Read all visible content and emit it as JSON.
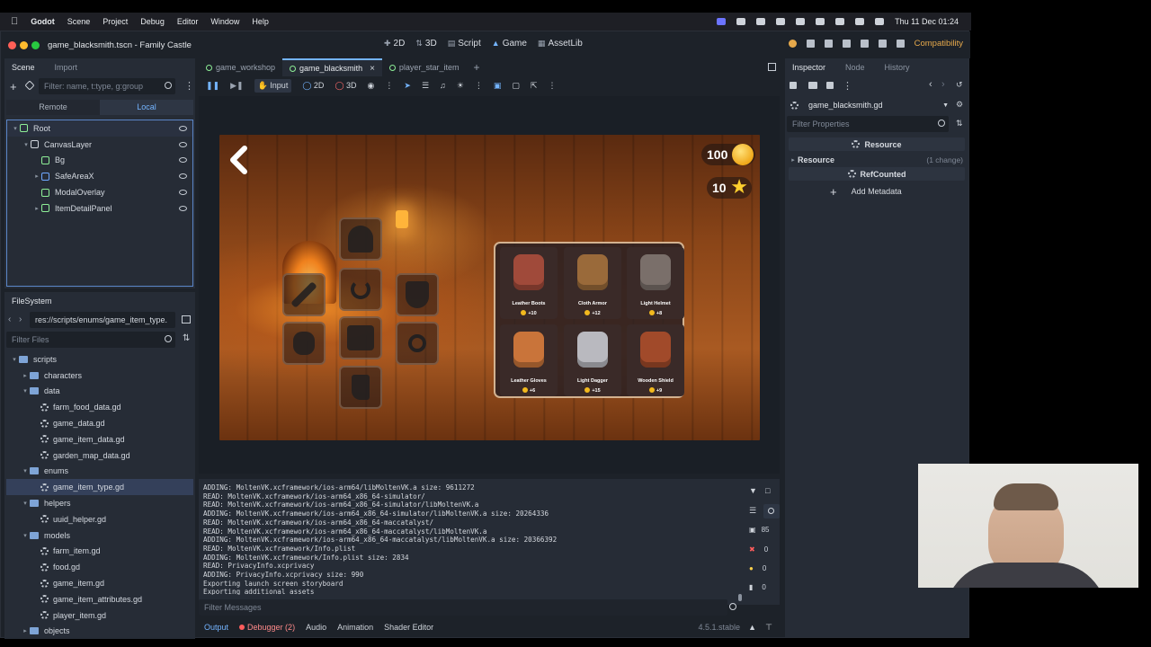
{
  "menubar": {
    "app_name": "Godot",
    "items": [
      "Scene",
      "Project",
      "Debug",
      "Editor",
      "Window",
      "Help"
    ],
    "clock": "Thu 11 Dec  01:24"
  },
  "window": {
    "title": "game_blacksmith.tscn - Family Castle",
    "main_screens": [
      "2D",
      "3D",
      "Script",
      "Game",
      "AssetLib"
    ],
    "active_screen": "Game",
    "renderer": "Compatibility"
  },
  "scene_dock": {
    "tabs": [
      "Scene",
      "Import"
    ],
    "filter_placeholder": "Filter: name, t:type, g:group",
    "remote_label": "Remote",
    "local_label": "Local",
    "nodes": [
      {
        "name": "Root",
        "depth": 0,
        "color": "#8eef97"
      },
      {
        "name": "CanvasLayer",
        "depth": 1,
        "color": "#d0d5dc"
      },
      {
        "name": "Bg",
        "depth": 2,
        "color": "#8eef97"
      },
      {
        "name": "SafeAreaX",
        "depth": 2,
        "color": "#6fa8ff"
      },
      {
        "name": "ModalOverlay",
        "depth": 2,
        "color": "#8eef97"
      },
      {
        "name": "ItemDetailPanel",
        "depth": 2,
        "color": "#8eef97"
      }
    ]
  },
  "filesystem": {
    "tab": "FileSystem",
    "path": "res://scripts/enums/game_item_type.",
    "filter_placeholder": "Filter Files",
    "entries": [
      {
        "name": "scripts",
        "type": "folder",
        "depth": 0
      },
      {
        "name": "characters",
        "type": "folder",
        "depth": 1
      },
      {
        "name": "data",
        "type": "folder",
        "depth": 1
      },
      {
        "name": "farm_food_data.gd",
        "type": "file",
        "depth": 2
      },
      {
        "name": "game_data.gd",
        "type": "file",
        "depth": 2
      },
      {
        "name": "game_item_data.gd",
        "type": "file",
        "depth": 2
      },
      {
        "name": "garden_map_data.gd",
        "type": "file",
        "depth": 2
      },
      {
        "name": "enums",
        "type": "folder",
        "depth": 1
      },
      {
        "name": "game_item_type.gd",
        "type": "file",
        "depth": 2,
        "selected": true
      },
      {
        "name": "helpers",
        "type": "folder",
        "depth": 1
      },
      {
        "name": "uuid_helper.gd",
        "type": "file",
        "depth": 2
      },
      {
        "name": "models",
        "type": "folder",
        "depth": 1
      },
      {
        "name": "farm_item.gd",
        "type": "file",
        "depth": 2
      },
      {
        "name": "food.gd",
        "type": "file",
        "depth": 2
      },
      {
        "name": "game_item.gd",
        "type": "file",
        "depth": 2
      },
      {
        "name": "game_item_attributes.gd",
        "type": "file",
        "depth": 2
      },
      {
        "name": "player_item.gd",
        "type": "file",
        "depth": 2
      },
      {
        "name": "objects",
        "type": "folder",
        "depth": 1
      }
    ]
  },
  "editor_tabs": [
    "game_workshop",
    "game_blacksmith",
    "player_star_item"
  ],
  "game_toolbar": {
    "input_label": "Input",
    "2d_label": "2D",
    "3d_label": "3D"
  },
  "game": {
    "coins": "100",
    "stars": "10",
    "shop_items": [
      {
        "name": "Leather Boots",
        "price": "+10",
        "color": "#a04a3a"
      },
      {
        "name": "Cloth Armor",
        "price": "+12",
        "color": "#9a6a3a"
      },
      {
        "name": "Light Helmet",
        "price": "+8",
        "color": "#7a6f6a"
      },
      {
        "name": "Leather Gloves",
        "price": "+6",
        "color": "#c9743a"
      },
      {
        "name": "Light Dagger",
        "price": "+15",
        "color": "#b9b9bf"
      },
      {
        "name": "Wooden Shield",
        "price": "+9",
        "color": "#a14a2a"
      }
    ]
  },
  "output": {
    "lines": [
      "ADDING: MoltenVK.xcframework/ios-arm64/libMoltenVK.a size: 9611272",
      "READ: MoltenVK.xcframework/ios-arm64_x86_64-simulator/",
      "READ: MoltenVK.xcframework/ios-arm64_x86_64-simulator/libMoltenVK.a",
      "ADDING: MoltenVK.xcframework/ios-arm64_x86_64-simulator/libMoltenVK.a size: 20264336",
      "READ: MoltenVK.xcframework/ios-arm64_x86_64-maccatalyst/",
      "READ: MoltenVK.xcframework/ios-arm64_x86_64-maccatalyst/libMoltenVK.a",
      "ADDING: MoltenVK.xcframework/ios-arm64_x86_64-maccatalyst/libMoltenVK.a size: 20366392",
      "READ: MoltenVK.xcframework/Info.plist",
      "ADDING: MoltenVK.xcframework/Info.plist size: 2834",
      "READ: PrivacyInfo.xcprivacy",
      "ADDING: PrivacyInfo.xcprivacy size: 990",
      "Exporting launch screen storyboard",
      "Exporting additional assets"
    ],
    "filter_placeholder": "Filter Messages",
    "counts": {
      "messages": "85",
      "errors": "0",
      "warnings": "0",
      "editor": "0"
    }
  },
  "bottom_tabs": [
    "Output",
    "Debugger (2)",
    "Audio",
    "Animation",
    "Shader Editor"
  ],
  "version": "4.5.1.stable",
  "inspector": {
    "tabs": [
      "Inspector",
      "Node",
      "History"
    ],
    "resource_name": "game_blacksmith.gd",
    "filter_placeholder": "Filter Properties",
    "section_resource": "Resource",
    "resource_row": "Resource",
    "resource_changes": "(1 change)",
    "section_refcounted": "RefCounted",
    "add_metadata": "Add Metadata"
  }
}
